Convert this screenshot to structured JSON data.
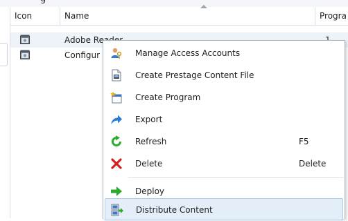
{
  "columns": {
    "icon": "Icon",
    "name": "Name",
    "programs": "Progra"
  },
  "rows": [
    {
      "name": "Adobe Reader",
      "programs": "1"
    },
    {
      "name": "Configur",
      "programs": ""
    }
  ],
  "context_menu": {
    "items": [
      {
        "label": "Manage Access Accounts",
        "icon": "user-key-icon"
      },
      {
        "label": "Create Prestage Content File",
        "icon": "document-file-icon"
      },
      {
        "label": "Create Program",
        "icon": "new-program-icon"
      },
      {
        "label": "Export",
        "icon": "export-arrow-icon"
      },
      {
        "label": "Refresh",
        "icon": "refresh-icon",
        "shortcut": "F5"
      },
      {
        "label": "Delete",
        "icon": "delete-x-icon",
        "shortcut": "Delete"
      },
      {
        "label": "Deploy",
        "icon": "deploy-arrow-icon"
      },
      {
        "label": "Distribute Content",
        "icon": "distribute-content-icon",
        "highlighted": true
      }
    ]
  },
  "colors": {
    "selection": "#eef3fa",
    "menu_highlight": "#e4eef9",
    "delete_red": "#d42020",
    "green": "#2bab2b",
    "blue": "#2a7ad6"
  }
}
